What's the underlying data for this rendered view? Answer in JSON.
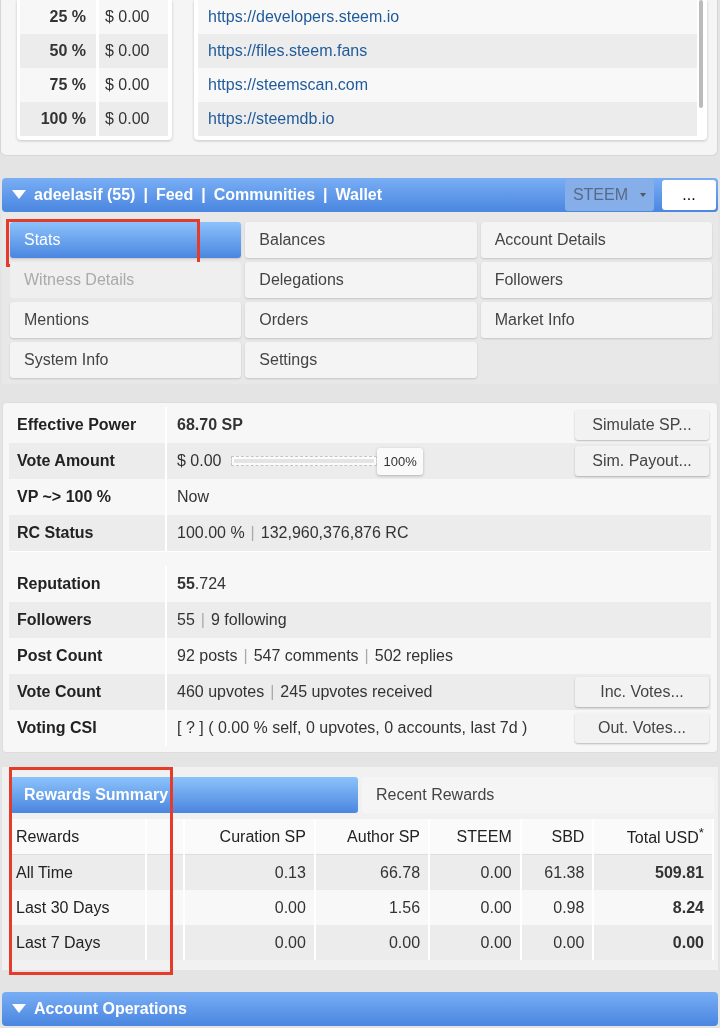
{
  "vote_table": {
    "rows": [
      {
        "percent": "25 %",
        "amount": "$ 0.00"
      },
      {
        "percent": "50 %",
        "amount": "$ 0.00"
      },
      {
        "percent": "75 %",
        "amount": "$ 0.00"
      },
      {
        "percent": "100 %",
        "amount": "$ 0.00"
      }
    ]
  },
  "links": [
    "https://developers.steem.io",
    "https://files.steem.fans",
    "https://steemscan.com",
    "https://steemdb.io"
  ],
  "account_bar": {
    "expanded": true,
    "separator": "|",
    "links": [
      "adeelasif (55)",
      "Feed",
      "Communities",
      "Wallet"
    ],
    "currency": "STEEM",
    "more_button": "..."
  },
  "tabs": [
    {
      "label": "Stats",
      "selected": true,
      "disabled": false,
      "highlighted": true
    },
    {
      "label": "Balances",
      "selected": false,
      "disabled": false,
      "highlighted": false
    },
    {
      "label": "Account Details",
      "selected": false,
      "disabled": false,
      "highlighted": false
    },
    {
      "label": "Witness Details",
      "selected": false,
      "disabled": true,
      "highlighted": false
    },
    {
      "label": "Delegations",
      "selected": false,
      "disabled": false,
      "highlighted": false
    },
    {
      "label": "Followers",
      "selected": false,
      "disabled": false,
      "highlighted": false
    },
    {
      "label": "Mentions",
      "selected": false,
      "disabled": false,
      "highlighted": false
    },
    {
      "label": "Orders",
      "selected": false,
      "disabled": false,
      "highlighted": false
    },
    {
      "label": "Market Info",
      "selected": false,
      "disabled": false,
      "highlighted": false
    },
    {
      "label": "System Info",
      "selected": false,
      "disabled": false,
      "highlighted": false
    },
    {
      "label": "Settings",
      "selected": false,
      "disabled": false,
      "highlighted": false
    }
  ],
  "stats_separator": "|",
  "stats": [
    [
      {
        "kind": "text",
        "label": "Effective Power",
        "values": [
          "68.70 SP"
        ],
        "bold": true,
        "button": "Simulate SP..."
      },
      {
        "kind": "slider",
        "label": "Vote Amount",
        "values": [
          "$ 0.00"
        ],
        "level": 1,
        "reading": "100%",
        "button": "Sim. Payout..."
      },
      {
        "kind": "text",
        "label": "VP ~> 100 %",
        "values": [
          "Now"
        ]
      },
      {
        "kind": "text",
        "label": "RC Status",
        "values": [
          "100.00 %",
          "132,960,376,876 RC"
        ]
      }
    ],
    [
      {
        "kind": "text",
        "label": "Reputation",
        "values": [
          "**55**.724"
        ]
      },
      {
        "kind": "text",
        "label": "Followers",
        "values": [
          "55",
          "9 following"
        ]
      },
      {
        "kind": "text",
        "label": "Post Count",
        "values": [
          "92 posts",
          "547 comments",
          "502 replies"
        ]
      },
      {
        "kind": "text",
        "label": "Vote Count",
        "values": [
          "460 upvotes",
          "245 upvotes received"
        ],
        "button": "Inc. Votes..."
      },
      {
        "kind": "text",
        "label": "Voting CSI",
        "values": [
          "[ ? ] ( 0.00 % self, 0 upvotes, 0 accounts, last 7d )"
        ],
        "button": "Out. Votes..."
      }
    ]
  ],
  "rewards": {
    "tabs": [
      {
        "label": "Rewards Summary",
        "selected": true
      },
      {
        "label": "Recent Rewards",
        "selected": false
      }
    ],
    "first_column_highlighted": true,
    "columns": [
      "Rewards",
      "Curation SP",
      "Author SP",
      "STEEM",
      "SBD",
      "Total USD$^{*}$"
    ],
    "rows": [
      [
        "All Time",
        "0.13",
        "66.78",
        "0.00",
        "61.38",
        "509.81"
      ],
      [
        "Last 30 Days",
        "0.00",
        "1.56",
        "0.00",
        "0.98",
        "8.24"
      ],
      [
        "Last 7 Days",
        "0.00",
        "0.00",
        "0.00",
        "0.00",
        "0.00"
      ]
    ]
  },
  "account_operations": {
    "title": "Account Operations",
    "expanded": true
  }
}
